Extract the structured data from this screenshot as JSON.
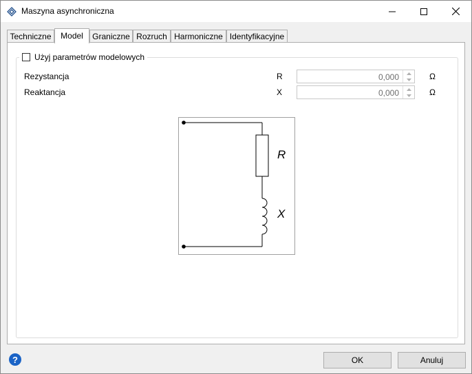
{
  "window": {
    "title": "Maszyna asynchroniczna",
    "icon": "diamond-app-icon",
    "controls": {
      "minimize": "minimize-icon",
      "maximize": "maximize-icon",
      "close": "close-icon"
    }
  },
  "tabs": [
    {
      "label": "Techniczne",
      "active": false
    },
    {
      "label": "Model",
      "active": true
    },
    {
      "label": "Graniczne",
      "active": false
    },
    {
      "label": "Rozruch",
      "active": false
    },
    {
      "label": "Harmoniczne",
      "active": false
    },
    {
      "label": "Identyfikacyjne",
      "active": false
    }
  ],
  "model": {
    "use_model_params": {
      "label": "Użyj parametrów modelowych",
      "checked": false
    },
    "rows": [
      {
        "label": "Rezystancja",
        "symbol": "R",
        "value": "0,000",
        "unit": "Ω"
      },
      {
        "label": "Reaktancja",
        "symbol": "X",
        "value": "0,000",
        "unit": "Ω"
      }
    ],
    "diagram": {
      "r_label": "R",
      "x_label": "X"
    }
  },
  "footer": {
    "help_icon": "help-icon",
    "help_glyph": "?",
    "ok_label": "OK",
    "cancel_label": "Anuluj"
  }
}
